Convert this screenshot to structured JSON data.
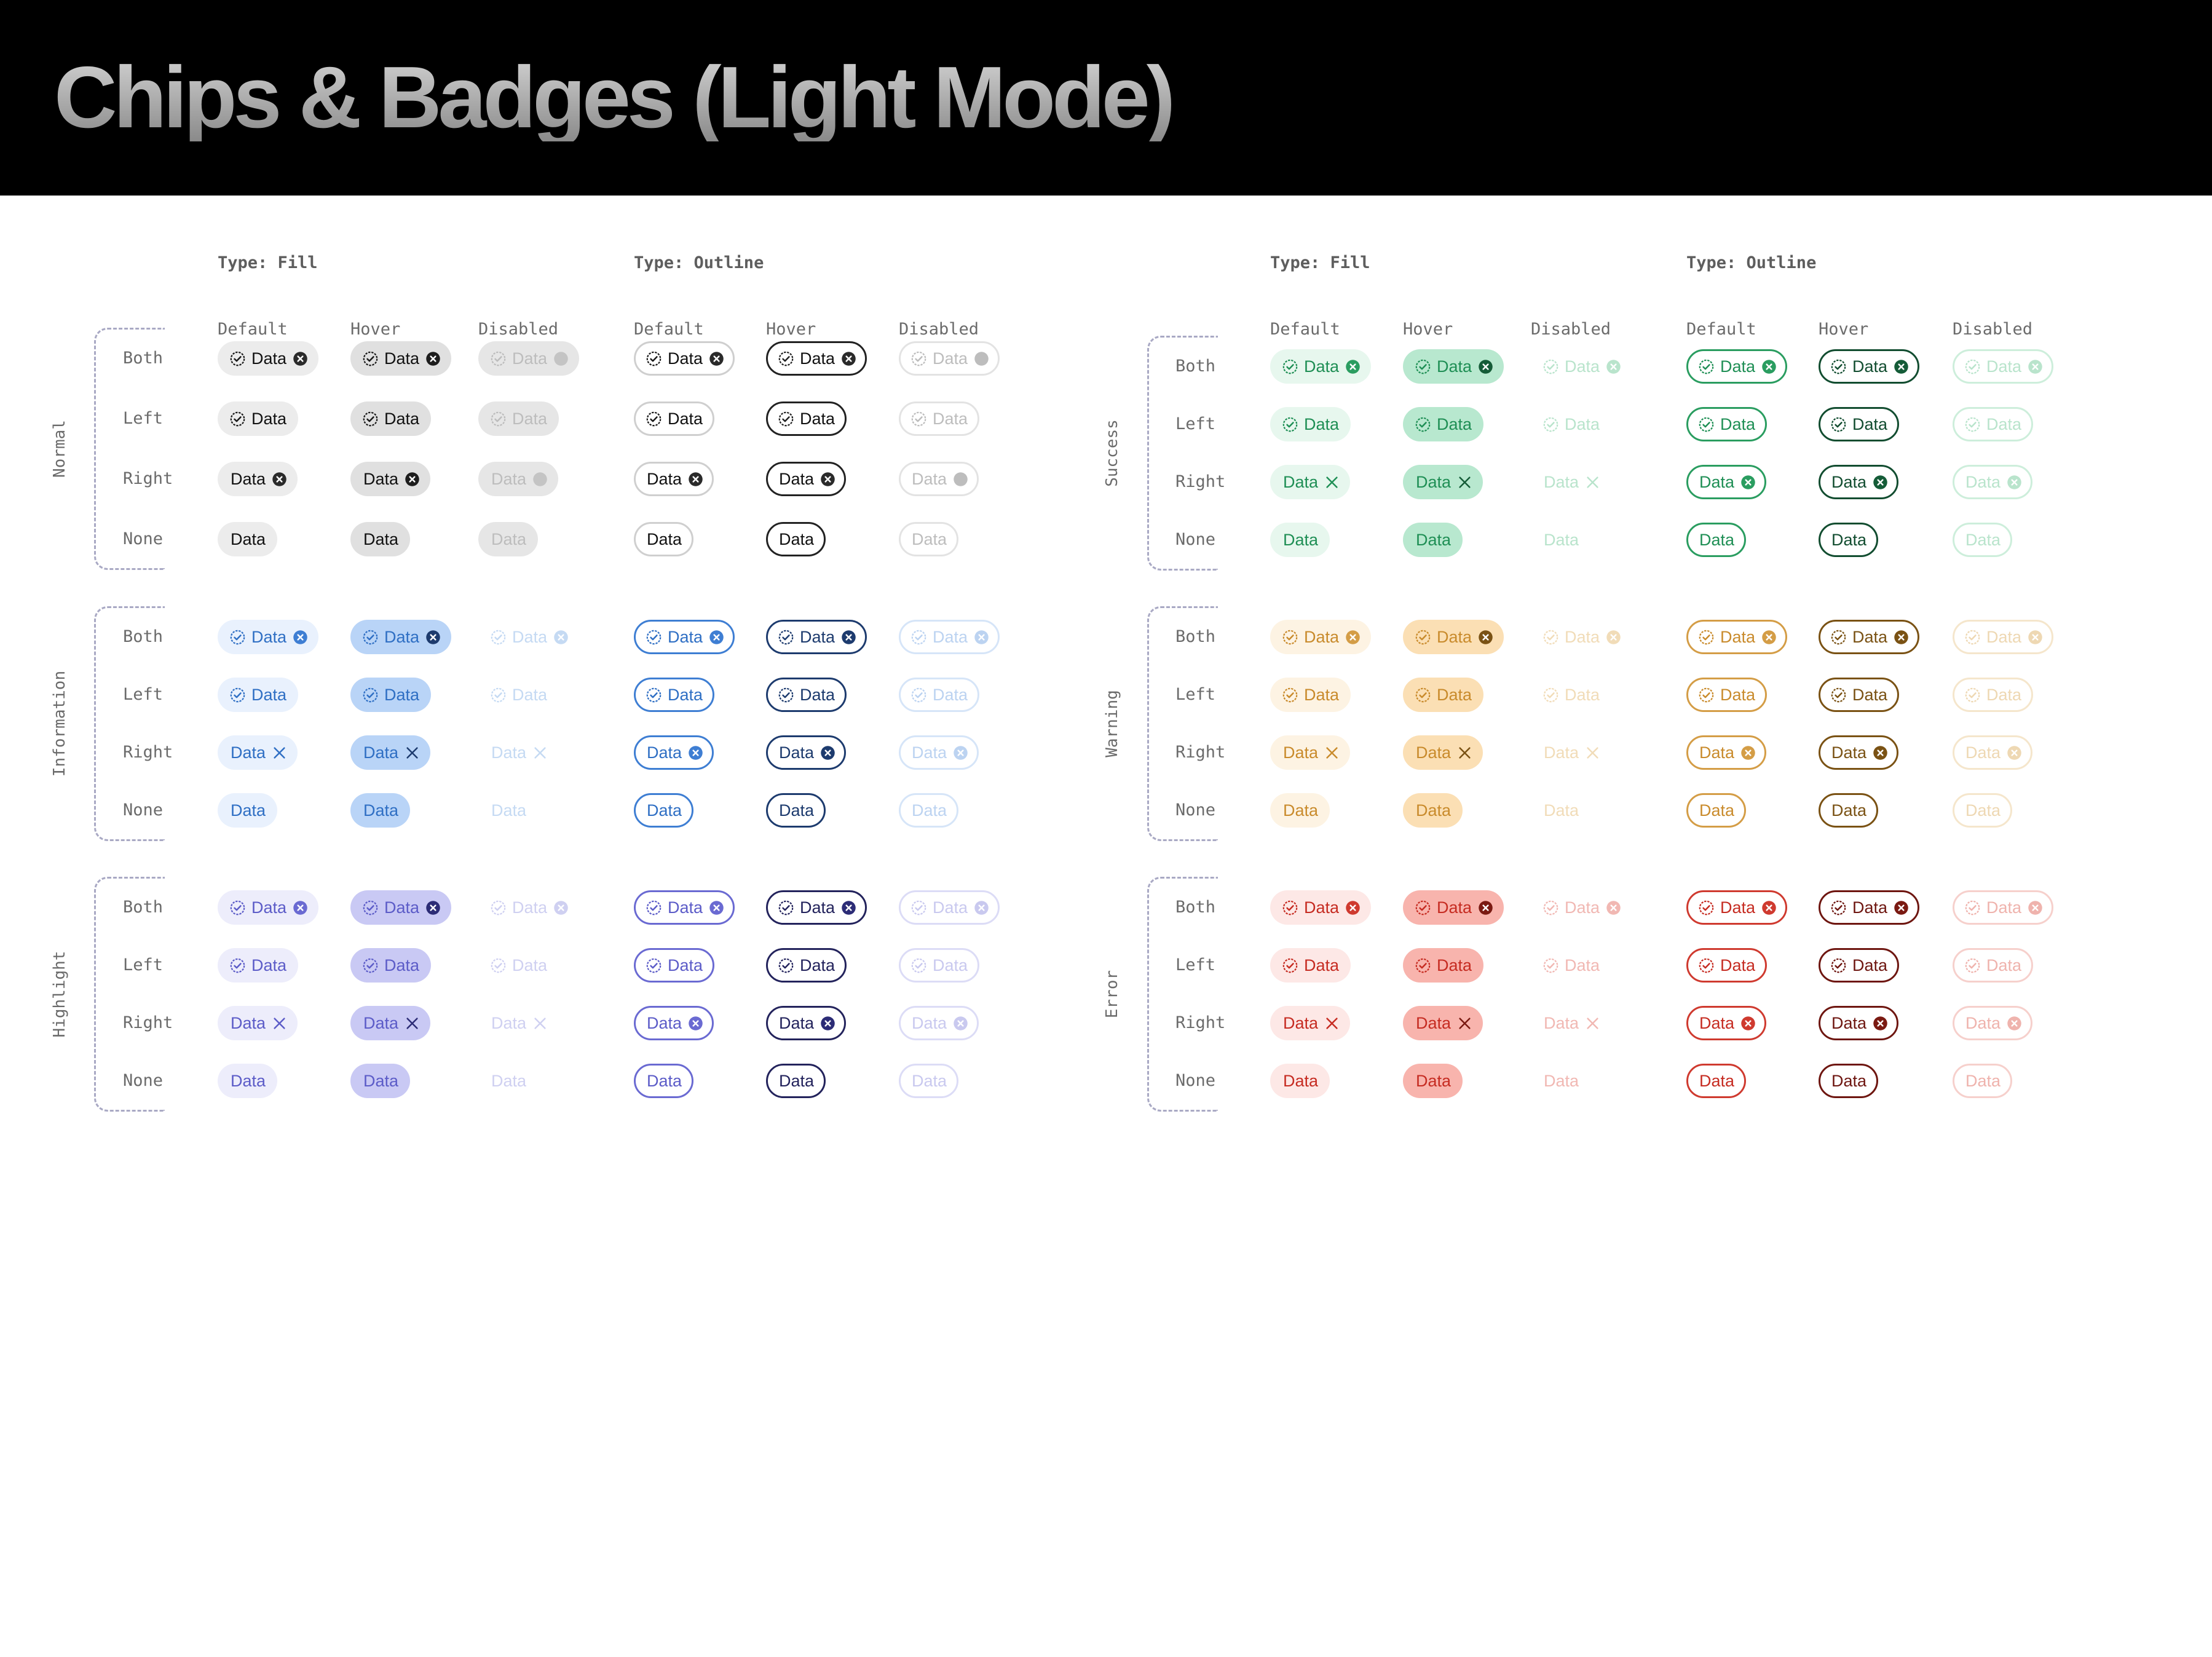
{
  "title": "Chips & Badges (Light Mode)",
  "chip_text": "Data",
  "type_labels": [
    "Type: Fill",
    "Type: Outline"
  ],
  "state_labels": [
    "Default",
    "Hover",
    "Disabled"
  ],
  "row_labels": [
    "Both",
    "Left",
    "Right",
    "None"
  ],
  "groups": [
    {
      "name": "Normal",
      "side": "left",
      "palette": {
        "text": "#111111",
        "fill": "#ececec",
        "hover": "#e0e0e0",
        "dis_fill": "#e6e6e6",
        "dis_text": "#bdbdbd",
        "ob": "#cfcfcf",
        "ob_hover": "#222222",
        "ob_dis": "#e3e3e3",
        "o_dis_text": "#bdbdbd",
        "dark": "#2a2a2a",
        "dark_hover": "#1d1d1d",
        "right_x": false
      }
    },
    {
      "name": "Information",
      "side": "left",
      "palette": {
        "text": "#2f6fc4",
        "fill": "#e9f1fd",
        "hover": "#b9d4f7",
        "dis_fill": "#ffffff",
        "dis_text": "#c5daf3",
        "ob": "#3e7ed3",
        "ob_hover": "#1d3b6e",
        "ob_dis": "#d6e5f8",
        "o_dis_text": "#bcd3f1",
        "dark": "#3e7ed3",
        "dark_hover": "#1d3b6e",
        "right_x": true
      }
    },
    {
      "name": "Highlight",
      "side": "left",
      "palette": {
        "text": "#5c5cc8",
        "fill": "#ededfb",
        "hover": "#c9c9f4",
        "dis_fill": "#ffffff",
        "dis_text": "#cfd0f1",
        "ob": "#6a6ad2",
        "ob_hover": "#23235c",
        "ob_dis": "#dcdcf6",
        "o_dis_text": "#c9c9ef",
        "dark": "#6a6ad2",
        "dark_hover": "#2c2c76",
        "right_x": true
      }
    },
    {
      "name": "Success",
      "side": "right",
      "palette": {
        "text": "#1f8f55",
        "fill": "#e7f7ee",
        "hover": "#b8e8cf",
        "dis_fill": "#ffffff",
        "dis_text": "#b9e4cc",
        "ob": "#2a9d60",
        "ob_hover": "#124d30",
        "ob_dis": "#cdeedb",
        "o_dis_text": "#b9e4cc",
        "dark": "#2a9d60",
        "dark_hover": "#155c38",
        "right_x": true
      }
    },
    {
      "name": "Warning",
      "side": "right",
      "palette": {
        "text": "#c98b2c",
        "fill": "#fdf3e3",
        "hover": "#fbdfb4",
        "dis_fill": "#ffffff",
        "dis_text": "#f1dcb8",
        "ob": "#d49d46",
        "ob_hover": "#7a5214",
        "ob_dis": "#f5e6cc",
        "o_dis_text": "#eed8b3",
        "dark": "#d49d46",
        "dark_hover": "#7a5214",
        "right_x": true
      }
    },
    {
      "name": "Error",
      "side": "right",
      "palette": {
        "text": "#c62c22",
        "fill": "#fde8e6",
        "hover": "#f8b4ad",
        "dis_fill": "#ffffff",
        "dis_text": "#f1b8b3",
        "ob": "#cf3a2f",
        "ob_hover": "#6e1610",
        "ob_dis": "#f6d0cc",
        "o_dis_text": "#efb3ad",
        "dark": "#cf3a2f",
        "dark_hover": "#7a1a12",
        "right_x": true
      }
    }
  ]
}
